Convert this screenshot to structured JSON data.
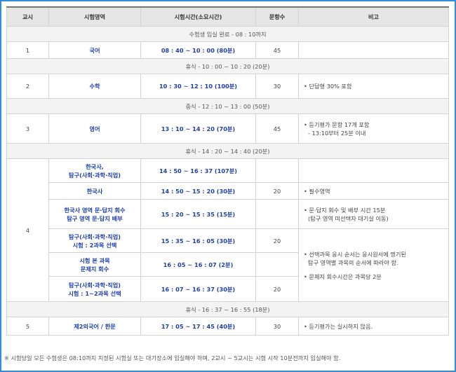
{
  "headers": [
    "교시",
    "시험영역",
    "시험시간(소요시간)",
    "문항수",
    "비고"
  ],
  "breaks": {
    "entry": "수험생 입실 완료 - 08 : 10까지",
    "rest1": "휴식 - 10 : 00 ~ 10 : 20 (20분)",
    "lunch": "중식 - 12 : 10 ~ 13 : 00 (50분)",
    "rest2": "휴식 - 14 : 20 ~ 14 : 40 (20분)",
    "rest3": "휴식 - 16 : 37 ~ 16 : 55 (18분)"
  },
  "periods": {
    "p1": {
      "num": "1",
      "subject": "국어",
      "time": "08 : 40 ~ 10 : 00 (80분)",
      "count": "45",
      "note": ""
    },
    "p2": {
      "num": "2",
      "subject": "수학",
      "time": "10 : 30 ~ 12 : 10 (100분)",
      "count": "30",
      "note": "• 단답형 30% 포함"
    },
    "p3": {
      "num": "3",
      "subject": "영어",
      "time": "13 : 10 ~ 14 : 20 (70분)",
      "count": "45",
      "note1": "• 듣기평가 문항 17개 포함",
      "note2": "- 13:10부터 25분 이내"
    },
    "p4": {
      "num": "4",
      "r1": {
        "subject1": "한국사,",
        "subject2": "탐구(사회·과학·직업)",
        "time": "14 : 50 ~ 16 : 37 (107분)"
      },
      "r2": {
        "subject": "한국사",
        "time": "14 : 50 ~ 15 : 20 (30분)",
        "count": "20",
        "note": "• 필수영역"
      },
      "r3": {
        "subject1": "한국사 영역 문·답지 회수",
        "subject2": "탐구 영역 문·답지 배부",
        "time": "15 : 20 ~ 15 : 35 (15분)",
        "note1": "• 문·답지 회수 및 배부 시간 15분",
        "note2": "(탐구 영역 미선택자 대기실 이동)"
      },
      "r4": {
        "subject1": "탐구(사회·과학·직업)",
        "subject2": "시험 : 2과목 선택",
        "time": "15 : 35 ~ 16 : 05 (30분)",
        "count": "20"
      },
      "r5": {
        "subject1": "시험 본 과목",
        "subject2": "문제지 회수",
        "time": "16 : 05 ~ 16 : 07 (2분)"
      },
      "r6": {
        "subject1": "탐구(사회·과학·직업)",
        "subject2": "시험 : 1~2과목 선택",
        "time": "16 : 07 ~ 16 : 37 (30분)",
        "count": "20"
      },
      "merged_note1": "• 선택과목 응시 순서는 응시원서에 명기된",
      "merged_note2": "탐구 영역별 과목의 순서에 따라야 함.",
      "merged_note3": "• 문제지 회수시간은 과목당 2분"
    },
    "p5": {
      "num": "5",
      "subject": "제2외국어 / 한문",
      "time": "17 : 05 ~ 17 : 45 (40분)",
      "count": "30",
      "note": "• 듣기평가는 실시하지 않음."
    }
  },
  "footnote": "※ 시험당일 모든 수험생은 08:10까지 지정된 시험실 또는 대기장소에 입실해야 하며, 2교시 ~ 5교시는 시험 시작 10분전까지 입실해야 함."
}
